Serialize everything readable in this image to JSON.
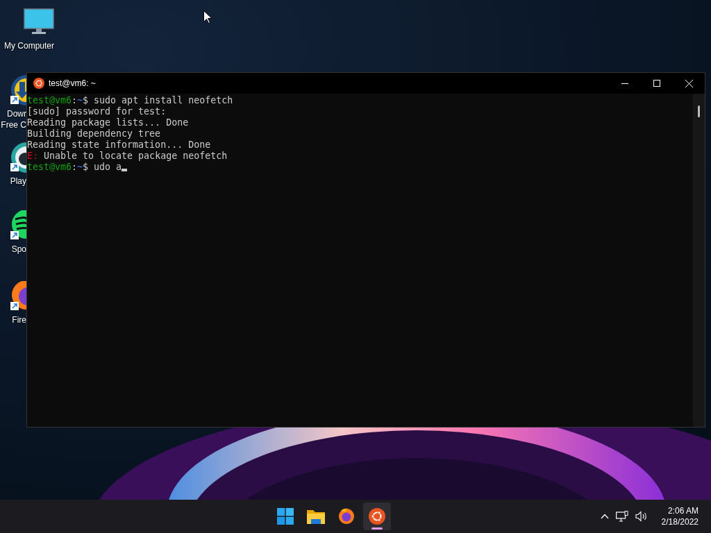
{
  "desktop_icons": [
    {
      "kind": "computer",
      "label_lines": [
        "My Computer"
      ]
    },
    {
      "kind": "download",
      "label_lines": [
        "Dowr",
        "Free C"
      ]
    },
    {
      "kind": "player",
      "label_lines": [
        "Play"
      ]
    },
    {
      "kind": "music",
      "label_lines": [
        "Spo"
      ]
    },
    {
      "kind": "browser",
      "label_lines": [
        "Fire"
      ]
    }
  ],
  "window": {
    "title": "test@vm6: ~",
    "lines": [
      {
        "kind": "prompt",
        "user": "test@vm6",
        "sep": ":",
        "path": "~",
        "text": "$ sudo apt install neofetch",
        "cursor": false
      },
      {
        "kind": "plain",
        "text": "[sudo] password for test:"
      },
      {
        "kind": "plain",
        "text": "Reading package lists... Done"
      },
      {
        "kind": "plain",
        "text": "Building dependency tree"
      },
      {
        "kind": "plain",
        "text": "Reading state information... Done"
      },
      {
        "kind": "error",
        "tag": "E:",
        "text": " Unable to locate package neofetch"
      },
      {
        "kind": "prompt",
        "user": "test@vm6",
        "sep": ":",
        "path": "~",
        "text": "$ udo a",
        "cursor": true
      }
    ]
  },
  "taskbar": {
    "apps": [
      {
        "kind": "start",
        "selected": false
      },
      {
        "kind": "folder",
        "selected": false
      },
      {
        "kind": "browser",
        "selected": false
      },
      {
        "kind": "terminal",
        "selected": true
      }
    ],
    "tray": {
      "time": "2:06 AM",
      "date": "2/18/2022"
    }
  }
}
